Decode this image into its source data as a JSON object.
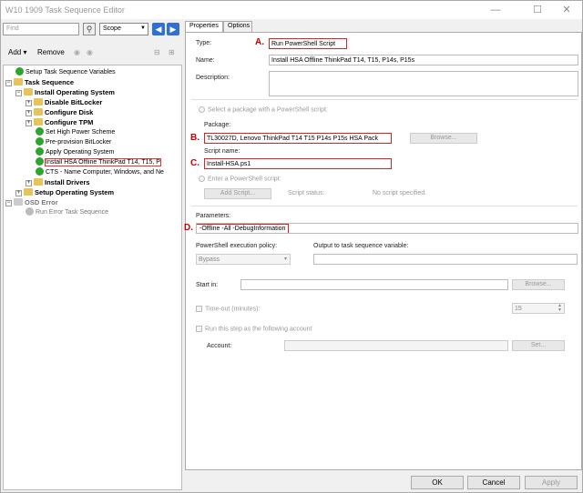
{
  "window": {
    "title": "W10 1909 Task Sequence Editor",
    "minimize": "—",
    "maximize": "☐",
    "close": "✕"
  },
  "left": {
    "search_placeholder": "Find",
    "scope": "Scope",
    "add": "Add",
    "remove": "Remove",
    "tree": [
      {
        "label": "Setup Task Sequence Variables",
        "icon": "check-icon",
        "indent": 1,
        "bold": false
      },
      {
        "label": "Task Sequence",
        "icon": "folder-icon",
        "indent": 0,
        "bold": true,
        "exp": "−"
      },
      {
        "label": "Install Operating System",
        "icon": "folder-check-icon",
        "indent": 1,
        "bold": true,
        "exp": "−"
      },
      {
        "label": "Disable BitLocker",
        "icon": "folder-check-icon",
        "indent": 2,
        "bold": true,
        "exp": "+"
      },
      {
        "label": "Configure Disk",
        "icon": "folder-check-icon",
        "indent": 2,
        "bold": true,
        "exp": "+"
      },
      {
        "label": "Configure TPM",
        "icon": "folder-check-icon",
        "indent": 2,
        "bold": true,
        "exp": "+"
      },
      {
        "label": "Set High Power Scheme",
        "icon": "check-icon",
        "indent": 3,
        "bold": false
      },
      {
        "label": "Pre-provision BitLocker",
        "icon": "check-icon",
        "indent": 3,
        "bold": false
      },
      {
        "label": "Apply Operating System",
        "icon": "check-icon",
        "indent": 3,
        "bold": false
      },
      {
        "label": "Install HSA Offline ThinkPad T14, T15, P",
        "icon": "check-icon",
        "indent": 3,
        "bold": false,
        "selected": true
      },
      {
        "label": "CTS - Name Computer, Windows, and Ne",
        "icon": "check-icon",
        "indent": 3,
        "bold": false
      },
      {
        "label": "Install Drivers",
        "icon": "folder-check-icon",
        "indent": 2,
        "bold": true,
        "exp": "+"
      },
      {
        "label": "Setup Operating System",
        "icon": "folder-check-icon",
        "indent": 1,
        "bold": true,
        "exp": "+"
      },
      {
        "label": "OSD Error",
        "icon": "folder-gray-icon",
        "indent": 0,
        "bold": true,
        "exp": "−",
        "gray": true
      },
      {
        "label": "Run Error Task Sequence",
        "icon": "gray-icon",
        "indent": 2,
        "bold": false,
        "gray": true
      }
    ]
  },
  "tabs": [
    "Properties",
    "Options"
  ],
  "props": {
    "type_label": "Type:",
    "type_value": "Run PowerShell Script",
    "name_label": "Name:",
    "name_value": "Install HSA Offline ThinkPad T14, T15, P14s, P15s",
    "desc_label": "Description:",
    "select_pkg": "Select a package with a PowerShell script:",
    "package_label": "Package:",
    "package_value": "TL30027D, Lenovo ThinkPad T14 T15 P14s P15s HSA Pack",
    "browse": "Browse...",
    "script_label": "Script name:",
    "script_value": "Install-HSA.ps1",
    "enter_script": "Enter a PowerShell script:",
    "add_script": "Add Script...",
    "script_status": "Script status:",
    "no_script": "No script specified.",
    "params_label": "Parameters:",
    "params_value": "-Offline -All -DebugInformation",
    "policy_label": "PowerShell execution policy:",
    "policy_value": "Bypass",
    "output_label": "Output to task sequence variable:",
    "start_label": "Start in:",
    "browse2": "Browse...",
    "timeout_label": "Time-out (minutes):",
    "timeout_value": "15",
    "run_as": "Run this step as the following account",
    "account_label": "Account:",
    "set": "Set..."
  },
  "markers": {
    "a": "A.",
    "b": "B.",
    "c": "C.",
    "d": "D."
  },
  "buttons": {
    "ok": "OK",
    "cancel": "Cancel",
    "apply": "Apply"
  }
}
